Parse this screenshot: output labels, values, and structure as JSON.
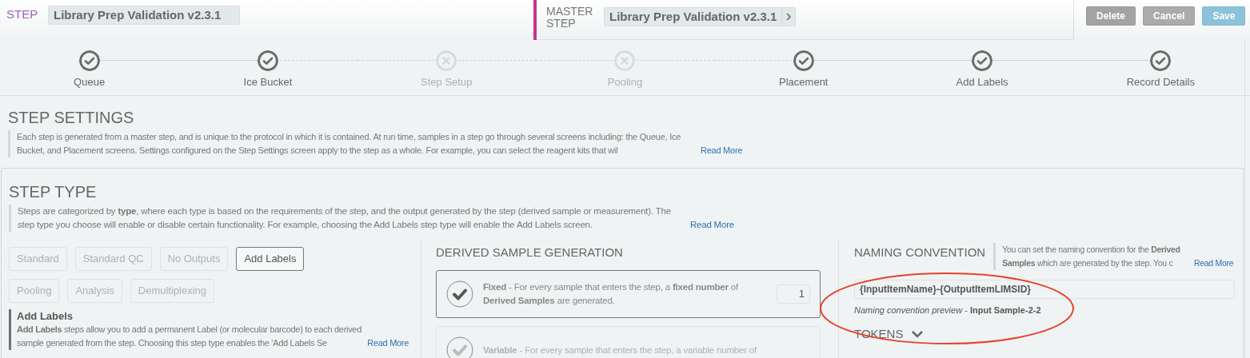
{
  "header": {
    "step_label": "STEP",
    "step_name": "Library Prep Validation v2.3.1",
    "master_label": "MASTER STEP",
    "master_name": "Library Prep Validation v2.3.1",
    "buttons": [
      {
        "label": "Delete",
        "kind": "delete"
      },
      {
        "label": "Cancel",
        "kind": "cancel"
      },
      {
        "label": "Save",
        "kind": "save"
      }
    ]
  },
  "stepper": [
    {
      "label": "Queue",
      "done": true
    },
    {
      "label": "Ice Bucket",
      "done": true
    },
    {
      "label": "Step Setup",
      "done": false
    },
    {
      "label": "Pooling",
      "done": false
    },
    {
      "label": "Placement",
      "done": true
    },
    {
      "label": "Add Labels",
      "done": true
    },
    {
      "label": "Record Details",
      "done": true
    }
  ],
  "step_settings": {
    "title": "STEP SETTINGS",
    "description": "Each step is generated from a master step, and is unique to the protocol in which it is contained. At run time, samples in a step go through several screens including: the Queue, Ice Bucket, and Placement screens. Settings configured on the Step Settings screen apply to the step as a whole. For example, you can select the reagent kits that wil",
    "read_more": "Read More"
  },
  "step_type": {
    "title": "STEP TYPE",
    "description": "Steps are categorized by **type**, where each type is based on the requirements of the step, and the output generated by the step (derived sample or measurement). The step type you choose will enable or disable certain functionality. For example, choosing the Add Labels step type will enable the Add Labels screen.",
    "read_more": "Read More",
    "types": [
      {
        "label": "Standard",
        "selected": false
      },
      {
        "label": "Standard QC",
        "selected": false
      },
      {
        "label": "No Outputs",
        "selected": false
      },
      {
        "label": "Add Labels",
        "selected": true
      },
      {
        "label": "Pooling",
        "selected": false
      },
      {
        "label": "Analysis",
        "selected": false
      },
      {
        "label": "Demultiplexing",
        "selected": false
      }
    ],
    "info": {
      "title": "Add Labels",
      "text": "**Add Labels** steps allow you to add a permanent Label (or molecular barcode) to each derived sample generated from the step. Choosing this step type enables the 'Add Labels Se",
      "read_more": "Read More"
    }
  },
  "derived_sample_generation": {
    "title": "DERIVED SAMPLE GENERATION",
    "options": [
      {
        "kind": "fixed",
        "selected": true,
        "text": "**Fixed** - For every sample that enters the step, a **fixed number** of **Derived Samples** are generated.",
        "value": "1"
      },
      {
        "kind": "variable",
        "selected": false,
        "text": "**Variable** - For every sample that enters the step, a variable number of"
      }
    ]
  },
  "naming_convention": {
    "title": "NAMING CONVENTION",
    "description": "You can set the naming convention for the **Derived Samples** which are generated by the step. You c",
    "read_more": "Read More",
    "value": "{InputItemName}-{OutputItemLIMSID}",
    "preview": "*Naming convention preview* - **Input Sample-2-2**",
    "tokens": {
      "label": "TOKENS",
      "expanded": false
    }
  },
  "annotation": {
    "kind": "ellipse"
  }
}
